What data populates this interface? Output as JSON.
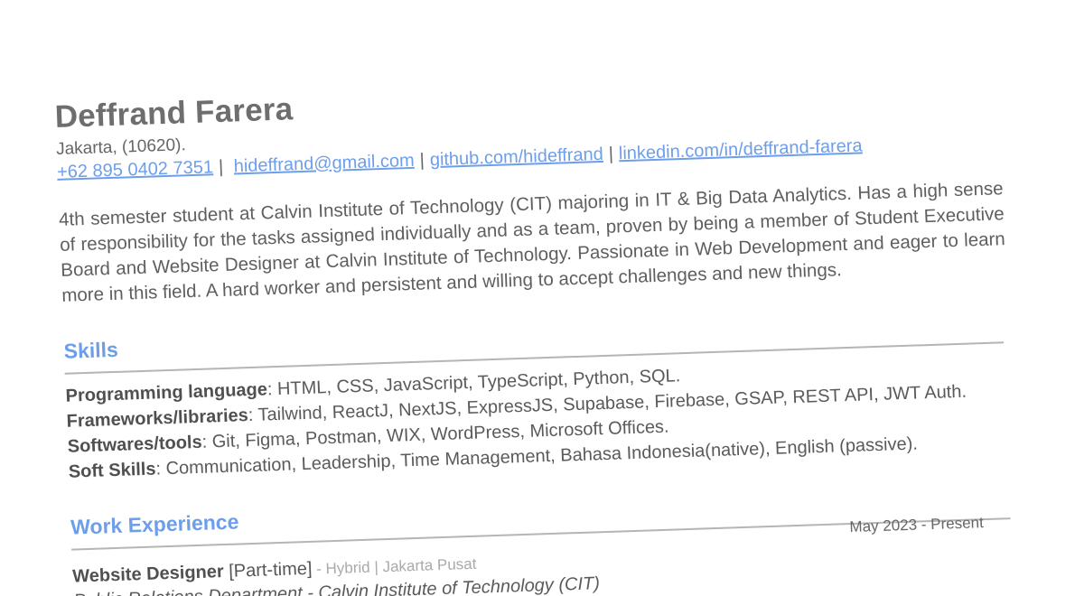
{
  "resume": {
    "name": "Deffrand Farera",
    "address": "Jakarta, (10620).",
    "contacts": {
      "phone": "+62 895 0402 7351",
      "email": "hideffrand@gmail.com",
      "github": "github.com/hideffrand",
      "linkedin": "linkedin.com/in/deffrand-farera",
      "separator": "|"
    },
    "summary": "4th semester student at Calvin Institute of Technology (CIT) majoring in IT & Big Data Analytics. Has a high sense of responsibility for the tasks assigned individually and as a team, proven by being a member of Student Executive Board and Website Designer at Calvin Institute of Technology. Passionate in Web Development and eager to learn more in this field. A hard worker and persistent and willing to accept challenges and new things."
  },
  "skills": {
    "title": "Skills",
    "rows": [
      {
        "label": "Programming language",
        "value": ": HTML, CSS, JavaScript, TypeScript, Python, SQL."
      },
      {
        "label": "Frameworks/libraries",
        "value": ": Tailwind, ReactJ, NextJS, ExpressJS, Supabase, Firebase, GSAP, REST API, JWT Auth."
      },
      {
        "label": "Softwares/tools",
        "value": ": Git, Figma, Postman, WIX, WordPress, Microsoft Offices."
      },
      {
        "label": "Soft Skills",
        "value": ": Communication, Leadership, Time Management, Bahasa Indonesia(native), English (passive)."
      }
    ]
  },
  "work": {
    "title": "Work Experience",
    "entries": [
      {
        "dates": "May 2023 - Present",
        "role": "Website Designer",
        "type": " [Part-time]",
        "meta": " - Hybrid | Jakarta Pusat",
        "department": "Public Relations Department - Calvin Institute of Technology (CIT)"
      }
    ]
  },
  "colors": {
    "accent": "#6d9eeb",
    "text": "#5a5a5a",
    "rule": "#b5b5b5"
  }
}
